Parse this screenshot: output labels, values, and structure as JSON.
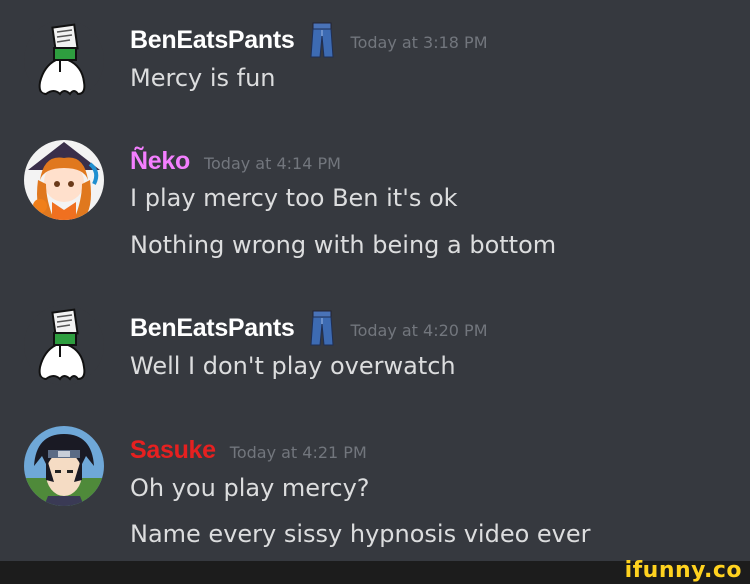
{
  "colors": {
    "background": "#36393f",
    "timestamp": "#72767d",
    "message_text": "#dcddde",
    "username_default": "#ffffff",
    "username_neko": "#f47fff",
    "username_sasuke": "#e62020",
    "brand": "#ffd21f"
  },
  "messages": [
    {
      "username": "BenEatsPants",
      "timestamp": "Today at 3:18 PM",
      "badge_icon": "jeans-icon",
      "avatar_icon": "ghost-holding-sign-icon",
      "lines": [
        "Mercy is fun"
      ]
    },
    {
      "username": "Ñeko",
      "timestamp": "Today at 4:14 PM",
      "avatar_icon": "anime-witch-girl-avatar",
      "lines": [
        "I play mercy too Ben it's ok",
        "Nothing wrong with being a bottom"
      ]
    },
    {
      "username": "BenEatsPants",
      "timestamp": "Today at 4:20 PM",
      "badge_icon": "jeans-icon",
      "avatar_icon": "ghost-holding-sign-icon",
      "lines": [
        "Well I don't play overwatch"
      ]
    },
    {
      "username": "Sasuke",
      "timestamp": "Today at 4:21 PM",
      "avatar_icon": "anime-ninja-boy-avatar",
      "lines": [
        "Oh you play mercy?",
        "Name every sissy hypnosis video ever"
      ]
    }
  ],
  "watermark": "ifunny.co"
}
